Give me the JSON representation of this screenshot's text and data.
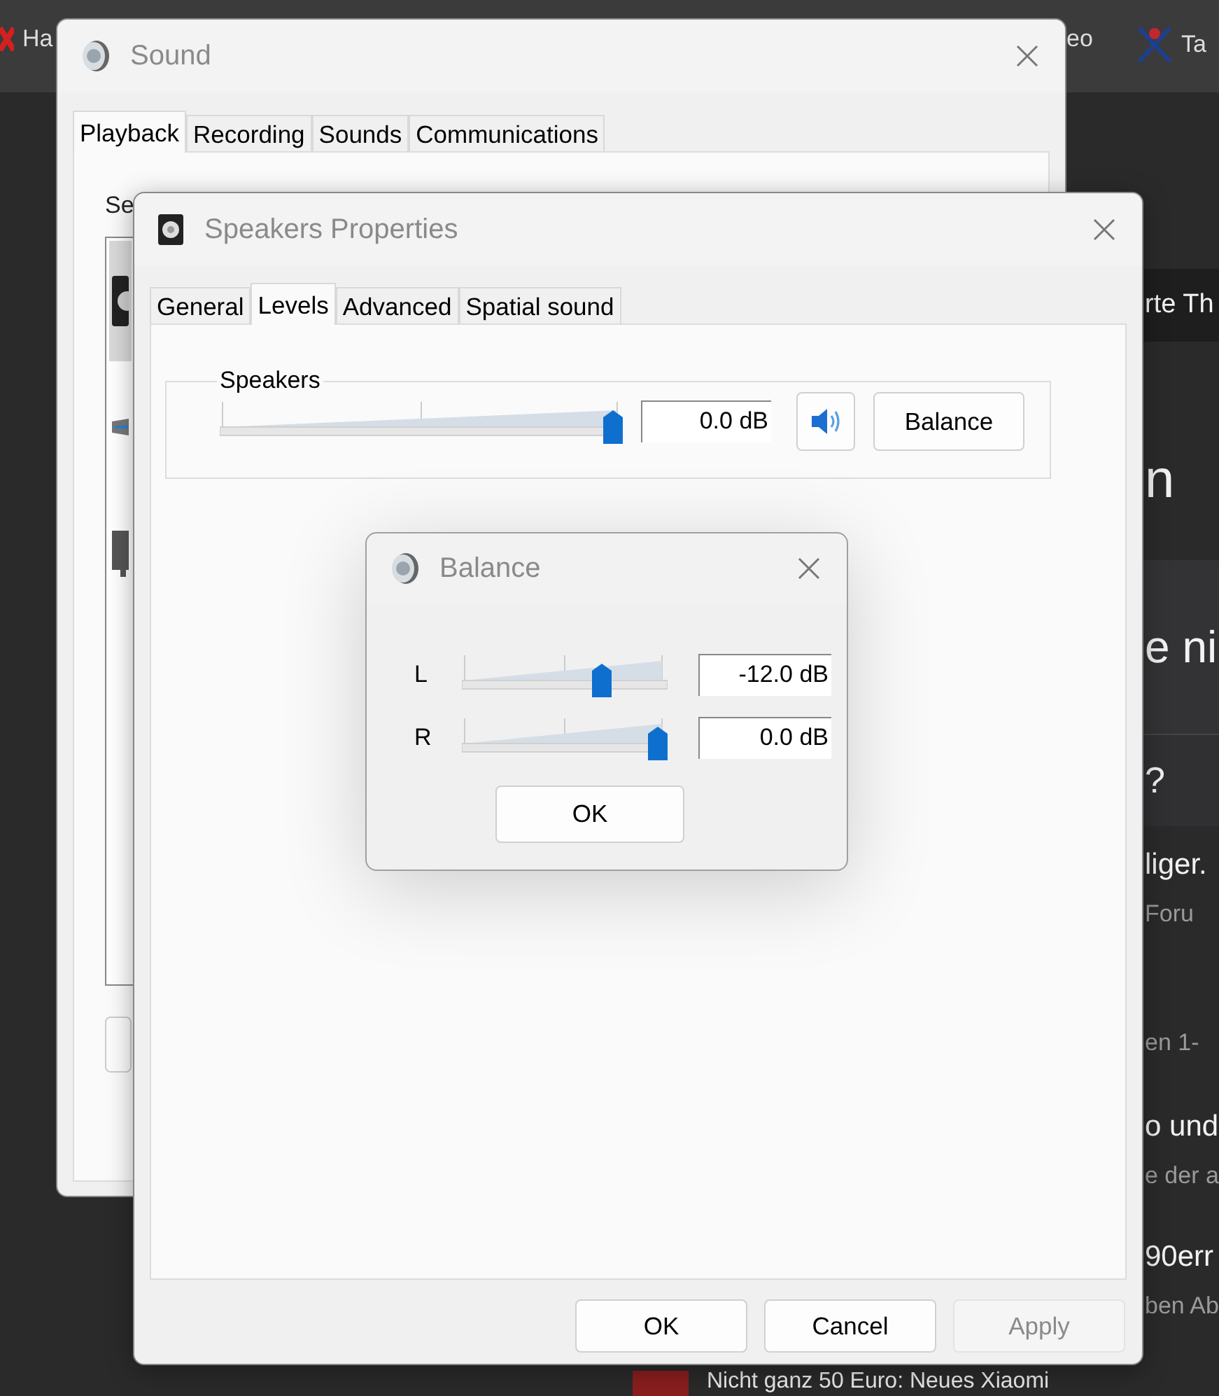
{
  "browser_bar": [
    {
      "kind": "mark-x",
      "label": "Ha"
    },
    {
      "kind": "plain",
      "label": "eo"
    },
    {
      "kind": "tools",
      "label": "Ta"
    }
  ],
  "background_page": {
    "items": [
      {
        "kind": "banner",
        "text": "rte Th"
      },
      {
        "kind": "heading",
        "text": "n"
      },
      {
        "kind": "heading-band",
        "text": "e ni"
      },
      {
        "kind": "question-band",
        "text": "?"
      },
      {
        "kind": "title",
        "text": "liger."
      },
      {
        "kind": "meta",
        "text": "Foru"
      },
      {
        "kind": "meta",
        "text": "en 1-"
      },
      {
        "kind": "title",
        "text": "o und"
      },
      {
        "kind": "meta",
        "text": "e der a"
      },
      {
        "kind": "title",
        "text": "90err"
      },
      {
        "kind": "meta",
        "text": "ben Ab"
      }
    ],
    "footer_headline": "Nicht ganz 50 Euro: Neues Xiaomi"
  },
  "sound_window": {
    "title": "Sound",
    "tabs": [
      {
        "label": "Playback",
        "selected": true
      },
      {
        "label": "Recording",
        "selected": false
      },
      {
        "label": "Sounds",
        "selected": false
      },
      {
        "label": "Communications",
        "selected": false
      }
    ],
    "intro": "Se",
    "devices": [
      {
        "kind": "speaker",
        "selected": true
      },
      {
        "kind": "dock",
        "selected": false
      },
      {
        "kind": "monitor",
        "selected": false
      }
    ]
  },
  "speakers_window": {
    "title": "Speakers Properties",
    "tabs": [
      {
        "label": "General",
        "selected": false
      },
      {
        "label": "Levels",
        "selected": true
      },
      {
        "label": "Advanced",
        "selected": false
      },
      {
        "label": "Spatial sound",
        "selected": false
      }
    ],
    "group": {
      "label": "Speakers",
      "level": 1,
      "reading": "0.0 dB",
      "muted": false,
      "balance_button": "Balance"
    },
    "buttons": [
      {
        "label": "OK",
        "disabled": false
      },
      {
        "label": "Cancel",
        "disabled": false
      },
      {
        "label": "Apply",
        "disabled": true
      }
    ]
  },
  "balance_dialog": {
    "title": "Balance",
    "channels": [
      {
        "name": "L",
        "level": 0.7,
        "reading": "-12.0 dB"
      },
      {
        "name": "R",
        "level": 1,
        "reading": "0.0 dB"
      }
    ],
    "ok_button": "OK"
  }
}
